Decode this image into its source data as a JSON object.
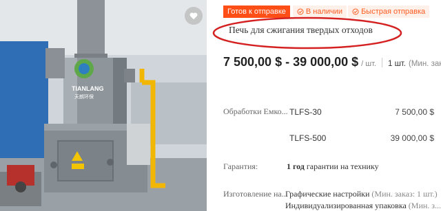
{
  "photo": {
    "brand_text": "TIANLANG",
    "brand_sub": "天朗环保"
  },
  "badges": {
    "ready": "Готов к отправке",
    "in_stock": "В наличии",
    "fast": "Быстрая отправка"
  },
  "product": {
    "title": "Печь для сжигания твердых отходов",
    "price_range": "7 500,00 $ - 39 000,00 $",
    "unit": "/ шт.",
    "moq_value": "1 шт.",
    "moq_label": "(Мин. заказ"
  },
  "options": {
    "label": "Обработки Емко...",
    "variants": [
      {
        "name": "TLFS-30",
        "price": "7 500,00 $"
      },
      {
        "name": "TLFS-500",
        "price": "39 000,00 $"
      }
    ]
  },
  "warranty": {
    "label": "Гарантия:",
    "value_bold": "1 год",
    "value_rest": "гарантии на технику"
  },
  "customization": {
    "label": "Изготовление на...",
    "line1_main": "Графические настройки",
    "line1_note": "(Мин. заказ: 1 шт.)",
    "line2_main": "Индивидуализированная упаковка",
    "line2_note": "(Мин. з..."
  },
  "colors": {
    "accent": "#ff4e16",
    "highlight_circle": "#d42020",
    "machine_gray": "#8a9096",
    "pipe_yellow": "#f2b705"
  }
}
